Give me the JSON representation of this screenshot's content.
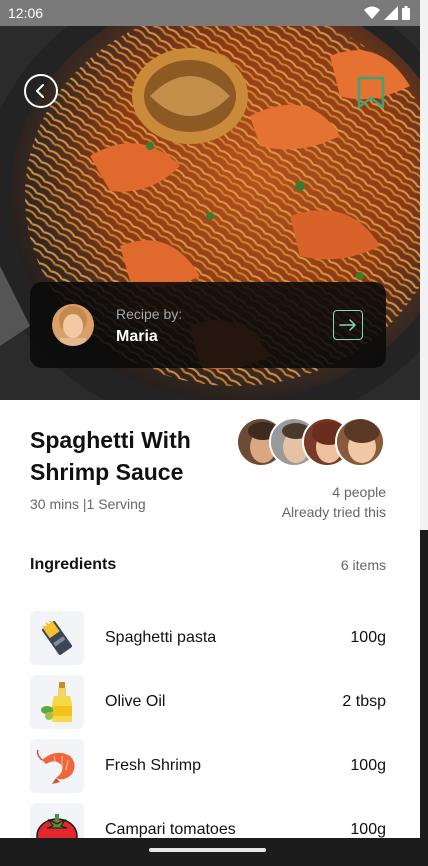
{
  "status": {
    "time": "12:06"
  },
  "recipe": {
    "title": "Spaghetti With Shrimp Sauce",
    "meta": "30 mins |1 Serving"
  },
  "author": {
    "label": "Recipe by:",
    "name": "Maria"
  },
  "tried": {
    "count_text": "4 people",
    "caption": "Already tried this"
  },
  "ingredients": {
    "heading": "Ingredients",
    "count_text": "6 items",
    "items": [
      {
        "name": "Spaghetti pasta",
        "qty": "100g",
        "icon": "pasta-icon"
      },
      {
        "name": "Olive Oil",
        "qty": "2 tbsp",
        "icon": "olive-oil-icon"
      },
      {
        "name": "Fresh Shrimp",
        "qty": "100g",
        "icon": "shrimp-icon"
      },
      {
        "name": "Campari tomatoes",
        "qty": "100g",
        "icon": "tomato-icon"
      }
    ]
  },
  "icons": {
    "back": "chevron-left-icon",
    "bookmark": "bookmark-icon",
    "author_link": "arrow-right-icon"
  },
  "colors": {
    "accent": "#3aa37a",
    "card_bg": "#0a0a0a",
    "text_primary": "#111111",
    "text_secondary": "#666666"
  }
}
